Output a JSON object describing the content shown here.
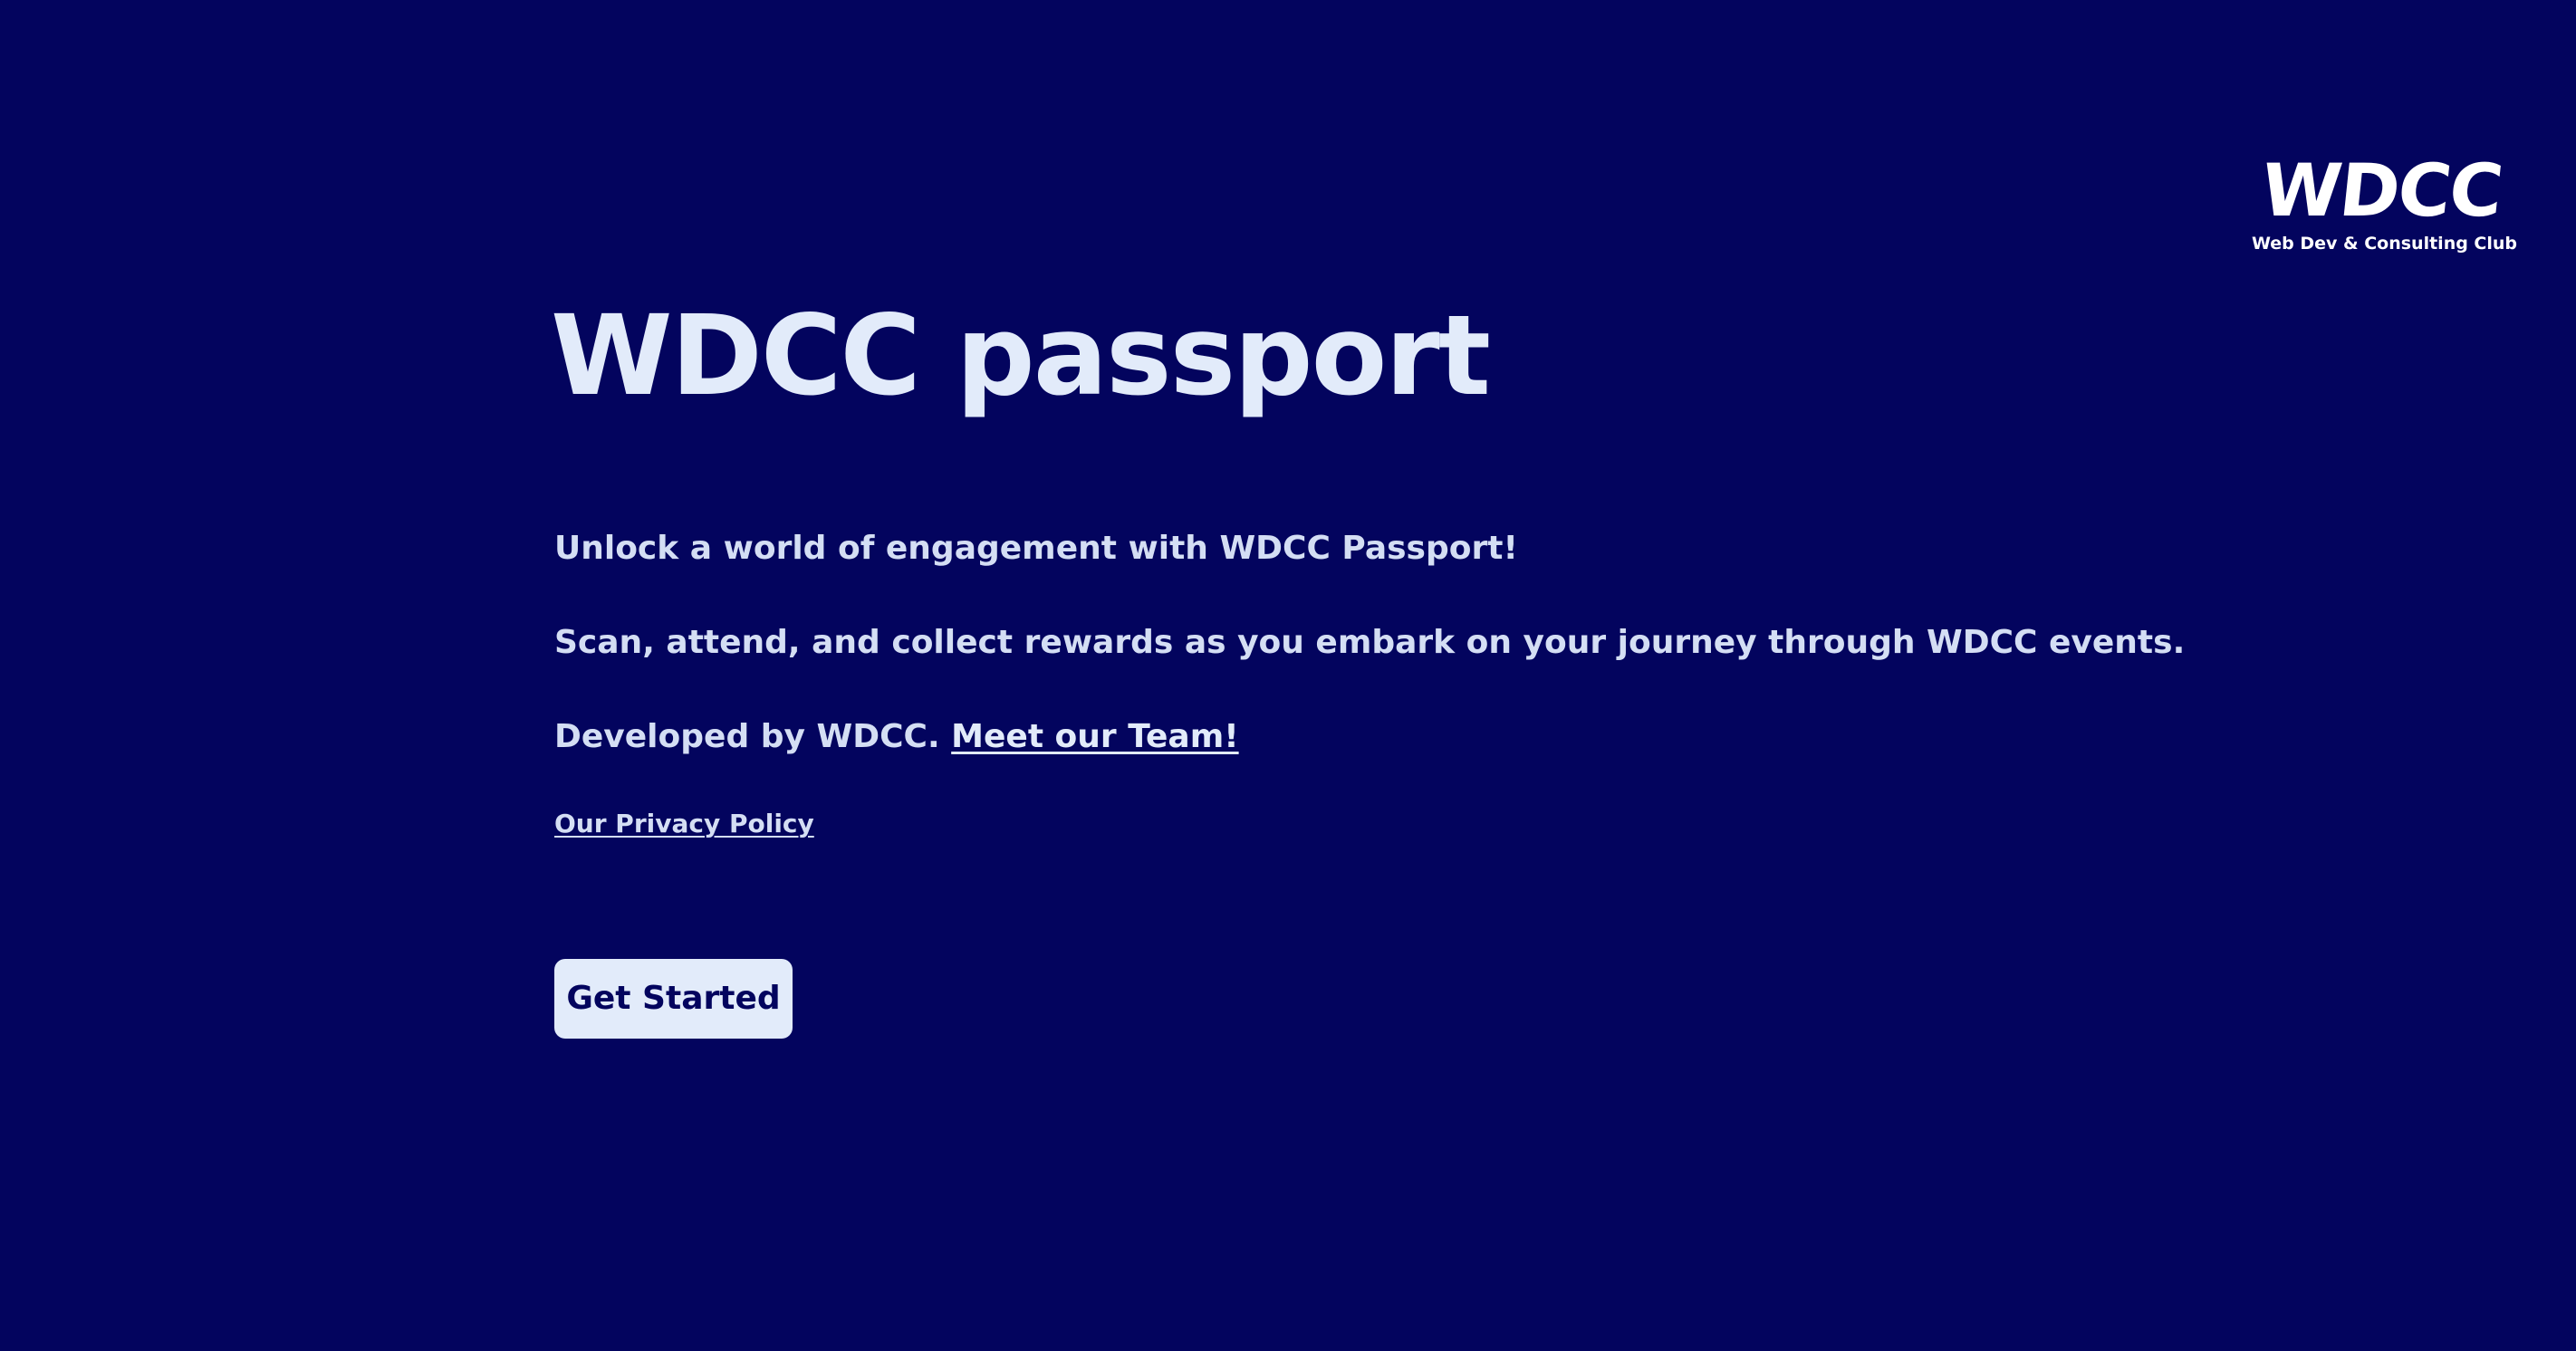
{
  "colors": {
    "background": "#03045e",
    "text": "#e2ebfa",
    "button_bg": "#e2ebfa",
    "button_text": "#03045e"
  },
  "logo": {
    "mark": "WDCC",
    "subtitle": "Web Dev & Consulting Club"
  },
  "hero": {
    "title": "WDCC passport",
    "line1": "Unlock a world of engagement with WDCC Passport!",
    "line2": "Scan, attend, and collect rewards as you embark on your journey through WDCC events.",
    "line3_prefix": "Developed by WDCC. ",
    "team_link": "Meet our Team!",
    "privacy_link": "Our Privacy Policy",
    "cta_label": "Get Started"
  }
}
